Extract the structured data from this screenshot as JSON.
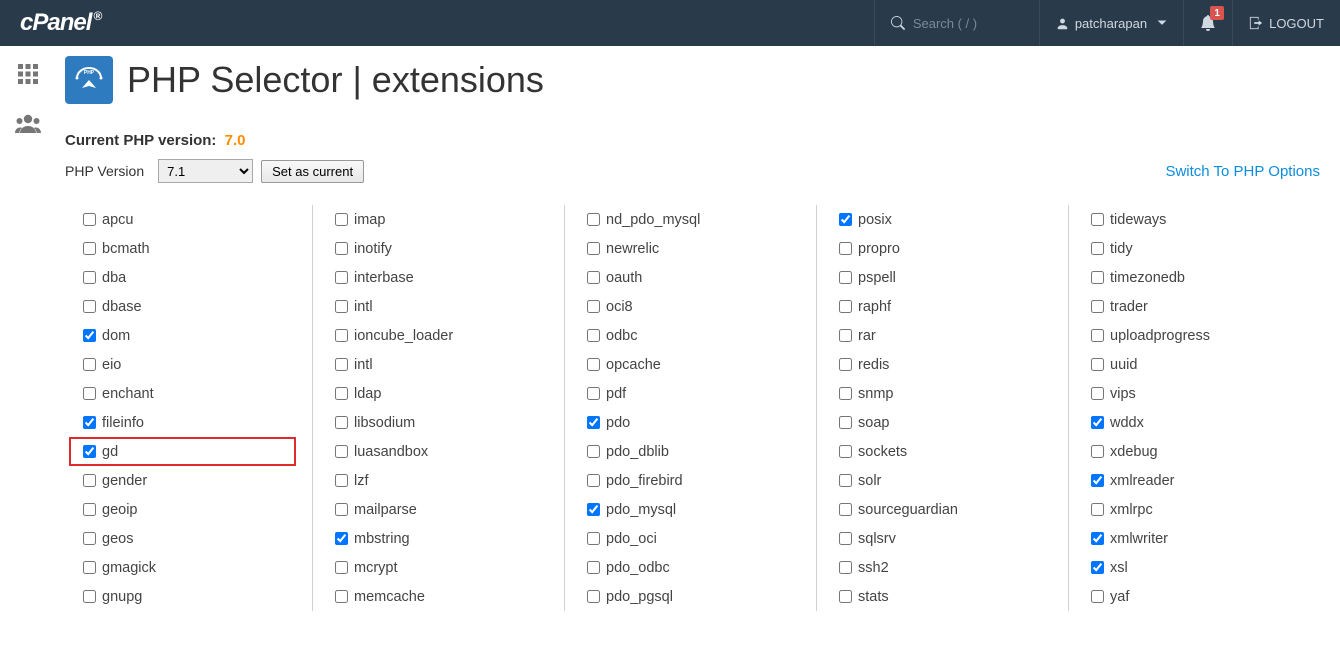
{
  "header": {
    "logo": "cPanel",
    "search_placeholder": "Search ( / )",
    "user": "patcharapan",
    "notif_count": "1",
    "logout": "LOGOUT"
  },
  "page": {
    "title": "PHP Selector | extensions",
    "current_label": "Current PHP version:",
    "current_value": "7.0",
    "version_label": "PHP Version",
    "version_value": "7.1",
    "set_button": "Set as current",
    "switch_link": "Switch To PHP Options"
  },
  "columns": [
    [
      {
        "name": "apcu",
        "checked": false
      },
      {
        "name": "bcmath",
        "checked": false
      },
      {
        "name": "dba",
        "checked": false
      },
      {
        "name": "dbase",
        "checked": false
      },
      {
        "name": "dom",
        "checked": true
      },
      {
        "name": "eio",
        "checked": false
      },
      {
        "name": "enchant",
        "checked": false
      },
      {
        "name": "fileinfo",
        "checked": true
      },
      {
        "name": "gd",
        "checked": true,
        "highlight": true
      },
      {
        "name": "gender",
        "checked": false
      },
      {
        "name": "geoip",
        "checked": false
      },
      {
        "name": "geos",
        "checked": false
      },
      {
        "name": "gmagick",
        "checked": false
      },
      {
        "name": "gnupg",
        "checked": false
      }
    ],
    [
      {
        "name": "imap",
        "checked": false
      },
      {
        "name": "inotify",
        "checked": false
      },
      {
        "name": "interbase",
        "checked": false
      },
      {
        "name": "intl",
        "checked": false
      },
      {
        "name": "ioncube_loader",
        "checked": false
      },
      {
        "name": "intl",
        "checked": false
      },
      {
        "name": "ldap",
        "checked": false
      },
      {
        "name": "libsodium",
        "checked": false
      },
      {
        "name": "luasandbox",
        "checked": false
      },
      {
        "name": "lzf",
        "checked": false
      },
      {
        "name": "mailparse",
        "checked": false
      },
      {
        "name": "mbstring",
        "checked": true
      },
      {
        "name": "mcrypt",
        "checked": false
      },
      {
        "name": "memcache",
        "checked": false
      }
    ],
    [
      {
        "name": "nd_pdo_mysql",
        "checked": false
      },
      {
        "name": "newrelic",
        "checked": false
      },
      {
        "name": "oauth",
        "checked": false
      },
      {
        "name": "oci8",
        "checked": false
      },
      {
        "name": "odbc",
        "checked": false
      },
      {
        "name": "opcache",
        "checked": false
      },
      {
        "name": "pdf",
        "checked": false
      },
      {
        "name": "pdo",
        "checked": true
      },
      {
        "name": "pdo_dblib",
        "checked": false
      },
      {
        "name": "pdo_firebird",
        "checked": false
      },
      {
        "name": "pdo_mysql",
        "checked": true
      },
      {
        "name": "pdo_oci",
        "checked": false
      },
      {
        "name": "pdo_odbc",
        "checked": false
      },
      {
        "name": "pdo_pgsql",
        "checked": false
      }
    ],
    [
      {
        "name": "posix",
        "checked": true
      },
      {
        "name": "propro",
        "checked": false
      },
      {
        "name": "pspell",
        "checked": false
      },
      {
        "name": "raphf",
        "checked": false
      },
      {
        "name": "rar",
        "checked": false
      },
      {
        "name": "redis",
        "checked": false
      },
      {
        "name": "snmp",
        "checked": false
      },
      {
        "name": "soap",
        "checked": false
      },
      {
        "name": "sockets",
        "checked": false
      },
      {
        "name": "solr",
        "checked": false
      },
      {
        "name": "sourceguardian",
        "checked": false
      },
      {
        "name": "sqlsrv",
        "checked": false
      },
      {
        "name": "ssh2",
        "checked": false
      },
      {
        "name": "stats",
        "checked": false
      }
    ],
    [
      {
        "name": "tideways",
        "checked": false
      },
      {
        "name": "tidy",
        "checked": false
      },
      {
        "name": "timezonedb",
        "checked": false
      },
      {
        "name": "trader",
        "checked": false
      },
      {
        "name": "uploadprogress",
        "checked": false
      },
      {
        "name": "uuid",
        "checked": false
      },
      {
        "name": "vips",
        "checked": false
      },
      {
        "name": "wddx",
        "checked": true
      },
      {
        "name": "xdebug",
        "checked": false
      },
      {
        "name": "xmlreader",
        "checked": true
      },
      {
        "name": "xmlrpc",
        "checked": false
      },
      {
        "name": "xmlwriter",
        "checked": true
      },
      {
        "name": "xsl",
        "checked": true
      },
      {
        "name": "yaf",
        "checked": false
      }
    ]
  ]
}
